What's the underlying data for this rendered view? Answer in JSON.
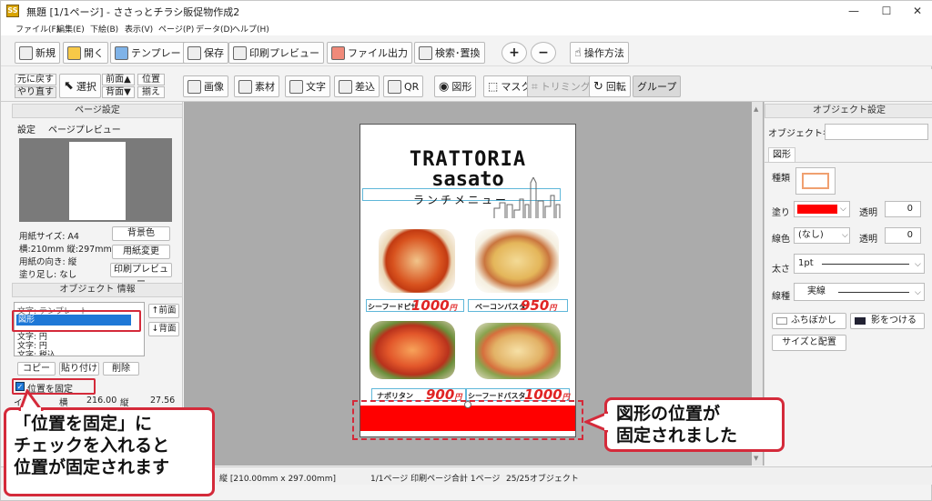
{
  "window": {
    "title": "無題 [1/1ページ] - ささっとチラシ販促物作成2",
    "icon_text": "SS",
    "controls": [
      "—",
      "☐",
      "✕"
    ]
  },
  "menubar": [
    "ファイル(F)",
    "編集(E)",
    "下絵(B)",
    "表示(V)",
    "ページ(P)",
    "データ(D)",
    "ヘルプ(H)"
  ],
  "toolbar_main": {
    "new": "新規",
    "open": "開く",
    "template": "テンプレート",
    "save": "保存",
    "print_preview": "印刷プレビュー",
    "file_output": "ファイル出力",
    "search_replace": "検索･置換",
    "zoom_in": "+",
    "zoom_out": "−",
    "how_to": "操作方法"
  },
  "toolbar_obj": {
    "undo": "元に戻す",
    "redo": "やり直す",
    "select": "選択",
    "front": "前面▲",
    "back": "背面▼",
    "align1": "位置",
    "align2": "揃え",
    "image": "画像",
    "material": "素材",
    "text": "文字",
    "merge": "差込",
    "qr": "QR",
    "shape": "図形",
    "mask": "マスク",
    "trimming": "トリミング",
    "rotate": "回転",
    "group": "グループ"
  },
  "page_settings": {
    "header": "ページ設定",
    "tabs": [
      "設定",
      "ページプレビュー"
    ],
    "paper_size": "用紙サイズ: A4",
    "dimensions": "横:210mm 縦:297mm",
    "orientation": "用紙の向き: 縦",
    "bleed": "塗り足し: なし",
    "bg_color_btn": "背景色",
    "change_paper_btn": "用紙変更",
    "print_preview_btn": "印刷プレビュー"
  },
  "object_info": {
    "header": "オブジェクト 情報",
    "list_items": [
      "文字: テンプレート",
      "図形",
      "文字: 円",
      "文字: 円",
      "文字: 税込"
    ],
    "selected_item": "図形",
    "bring_front": "↑前面",
    "send_back": "↓背面",
    "copy": "コピー",
    "paste": "貼り付け",
    "delete": "削除",
    "lock_position": "位置を固定",
    "size_label": "イズ",
    "width_label": "横",
    "width_value": "216.00",
    "height_label": "縦",
    "height_value": "27.56"
  },
  "flyer": {
    "title1": "TRATTORIA",
    "title2": "sasato",
    "subtitle": "ランチメニュー",
    "dishes": [
      {
        "name": "シーフードピザ",
        "price": "1000",
        "unit": "円"
      },
      {
        "name": "ベーコンパスタ",
        "price": "950",
        "unit": "円"
      },
      {
        "name": "ナポリタン",
        "price": "900",
        "unit": "円"
      },
      {
        "name": "シーフードパスタ",
        "price": "1000",
        "unit": "円"
      }
    ],
    "bar_color": "#ff0000"
  },
  "object_settings": {
    "header": "オブジェクト設定",
    "object_name_label": "オブジェクト名",
    "object_name_value": "",
    "tab": "図形",
    "type_label": "種類",
    "fill_label": "塗り",
    "fill_color": "#ff0000",
    "transparency_label": "透明",
    "fill_transparency": "0",
    "line_color_label": "線色",
    "line_color_value": "(なし)",
    "line_transparency": "0",
    "thickness_label": "太さ",
    "thickness_value": "1pt",
    "line_type_label": "線種",
    "line_type_value": "実線",
    "blur_btn": "ふちぼかし",
    "shadow_btn": "影をつける",
    "size_position_btn": "サイズと配置"
  },
  "statusbar": {
    "paper": "縦 [210.00mm x 297.00mm]",
    "pages": "1/1ページ 印刷ページ合計 1ページ",
    "objects": "25/25オブジェクト"
  },
  "callouts": {
    "left_line1": "「位置を固定」に",
    "left_line2": "チェックを入れると",
    "left_line3": "位置が固定されます",
    "right_line1": "図形の位置が",
    "right_line2": "固定されました"
  },
  "colors": {
    "accent_red": "#d42a3a",
    "selection_blue": "#1e78d7",
    "shape_red": "#ff0000"
  }
}
